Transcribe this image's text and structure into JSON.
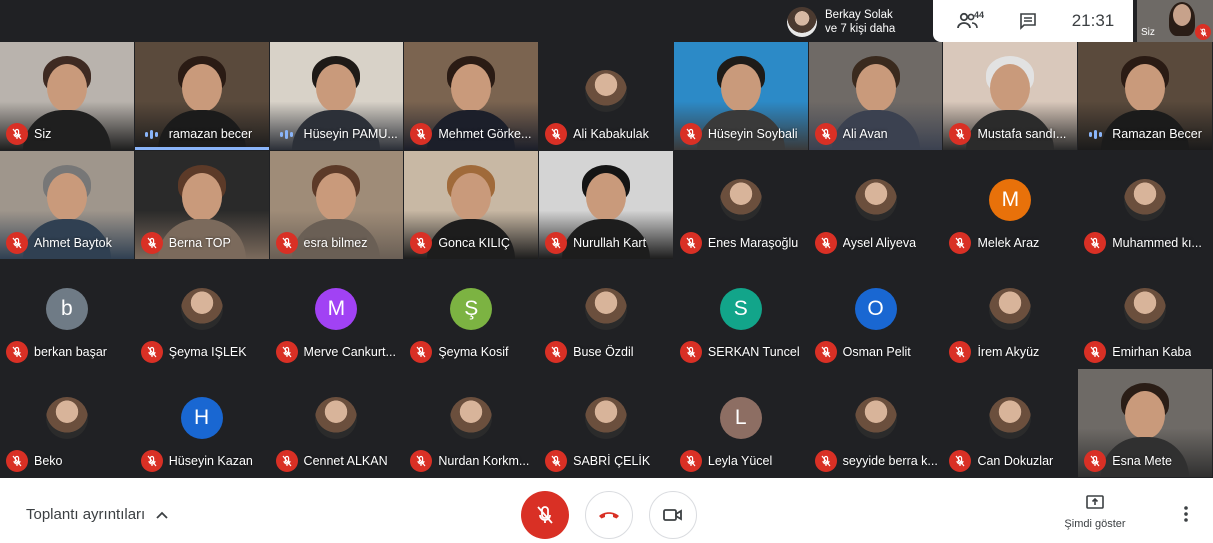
{
  "topbar": {
    "others_label_line1": "Berkay Solak",
    "others_label_line2": "ve 7 kişi daha",
    "participant_count": "44",
    "clock": "21:31",
    "self_label": "Siz"
  },
  "participants": [
    {
      "name": "Siz",
      "mic": "off",
      "kind": "video"
    },
    {
      "name": "ramazan becer",
      "mic": "speaking",
      "kind": "video",
      "active": true
    },
    {
      "name": "Hüseyin PAMU...",
      "mic": "speaking",
      "kind": "video"
    },
    {
      "name": "Mehmet Görke...",
      "mic": "off",
      "kind": "video"
    },
    {
      "name": "Ali Kabakulak",
      "mic": "off",
      "kind": "avatar"
    },
    {
      "name": "Hüseyin Soybali",
      "mic": "off",
      "kind": "video"
    },
    {
      "name": "Ali Avan",
      "mic": "off",
      "kind": "video"
    },
    {
      "name": "Mustafa sandı...",
      "mic": "off",
      "kind": "video"
    },
    {
      "name": "Ramazan Becer",
      "mic": "speaking",
      "kind": "video"
    },
    {
      "name": "Ahmet Baytok",
      "mic": "off",
      "kind": "video"
    },
    {
      "name": "Berna TOP",
      "mic": "off",
      "kind": "video"
    },
    {
      "name": "esra bilmez",
      "mic": "off",
      "kind": "video"
    },
    {
      "name": "Gonca KILIÇ",
      "mic": "off",
      "kind": "video"
    },
    {
      "name": "Nurullah Kart",
      "mic": "off",
      "kind": "video"
    },
    {
      "name": "Enes Maraşoğlu",
      "mic": "off",
      "kind": "photo"
    },
    {
      "name": "Aysel Aliyeva",
      "mic": "off",
      "kind": "photo"
    },
    {
      "name": "Melek Araz",
      "mic": "off",
      "kind": "letter",
      "letter": "M",
      "color": "#e8710a"
    },
    {
      "name": "Muhammed kı...",
      "mic": "off",
      "kind": "photo"
    },
    {
      "name": "berkan başar",
      "mic": "off",
      "kind": "letter",
      "letter": "b",
      "color": "#6f7b86"
    },
    {
      "name": "Şeyma IŞLEK",
      "mic": "off",
      "kind": "photo"
    },
    {
      "name": "Merve Cankurt...",
      "mic": "off",
      "kind": "letter",
      "letter": "M",
      "color": "#a142f4"
    },
    {
      "name": "Şeyma Kosif",
      "mic": "off",
      "kind": "letter",
      "letter": "Ş",
      "color": "#7cb342"
    },
    {
      "name": "Buse Özdil",
      "mic": "off",
      "kind": "photo"
    },
    {
      "name": "SERKAN Tuncel",
      "mic": "off",
      "kind": "letter",
      "letter": "S",
      "color": "#12a58a"
    },
    {
      "name": "Osman Pelit",
      "mic": "off",
      "kind": "letter",
      "letter": "O",
      "color": "#1967d2"
    },
    {
      "name": "İrem Akyüz",
      "mic": "off",
      "kind": "photo"
    },
    {
      "name": "Emirhan Kaba",
      "mic": "off",
      "kind": "photo"
    },
    {
      "name": "Beko",
      "mic": "off",
      "kind": "photo"
    },
    {
      "name": "Hüseyin Kazan",
      "mic": "off",
      "kind": "letter",
      "letter": "H",
      "color": "#1967d2"
    },
    {
      "name": "Cennet ALKAN",
      "mic": "off",
      "kind": "photo"
    },
    {
      "name": "Nurdan Korkm...",
      "mic": "off",
      "kind": "photo"
    },
    {
      "name": "SABRİ ÇELİK",
      "mic": "off",
      "kind": "photo"
    },
    {
      "name": "Leyla Yücel",
      "mic": "off",
      "kind": "letter",
      "letter": "L",
      "color": "#8d6e63"
    },
    {
      "name": "seyyide berra k...",
      "mic": "off",
      "kind": "photo"
    },
    {
      "name": "Can Dokuzlar",
      "mic": "off",
      "kind": "photo"
    },
    {
      "name": "Esna Mete",
      "mic": "off",
      "kind": "video"
    }
  ],
  "bottombar": {
    "meeting_details": "Toplantı ayrıntıları",
    "present_label": "Şimdi göster"
  },
  "icons": [
    "people-icon",
    "chat-icon",
    "mic-off-icon",
    "hangup-icon",
    "camera-icon",
    "present-icon",
    "more-vert-icon",
    "chevron-up-icon"
  ],
  "colors": {
    "mic_off": "#d93025",
    "active_speaker": "#8ab4f8",
    "stage": "#202124"
  }
}
